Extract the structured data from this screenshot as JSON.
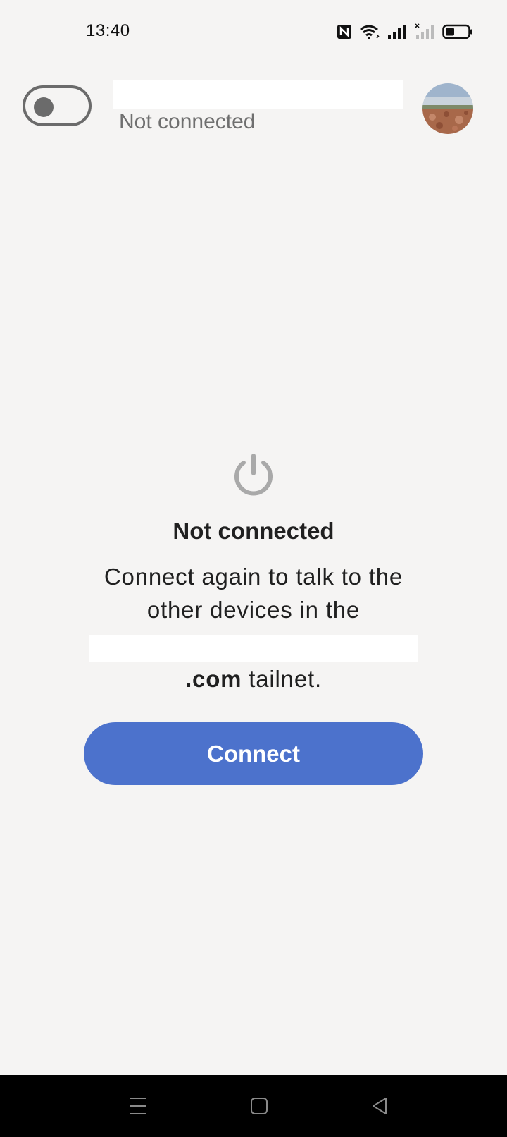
{
  "status_bar": {
    "time": "13:40",
    "icons": [
      "nfc-icon",
      "wifi-icon",
      "signal-icon",
      "signal-no-sim-icon",
      "battery-icon"
    ]
  },
  "header": {
    "vpn_toggle_state": "off",
    "connection_status": "Not connected",
    "avatar": "profile-photo"
  },
  "main": {
    "icon": "power-icon",
    "title": "Not connected",
    "description": "Connect again to talk to the other devices in the",
    "domain_suffix": ".com",
    "tailnet_word": " tailnet.",
    "button_label": "Connect"
  },
  "nav": {
    "items": [
      "menu-icon",
      "home-icon",
      "back-icon"
    ]
  },
  "colors": {
    "background": "#f5f4f3",
    "accent": "#4c72cc",
    "muted_text": "#6f6f6f",
    "toggle": "#6b6b6b"
  }
}
